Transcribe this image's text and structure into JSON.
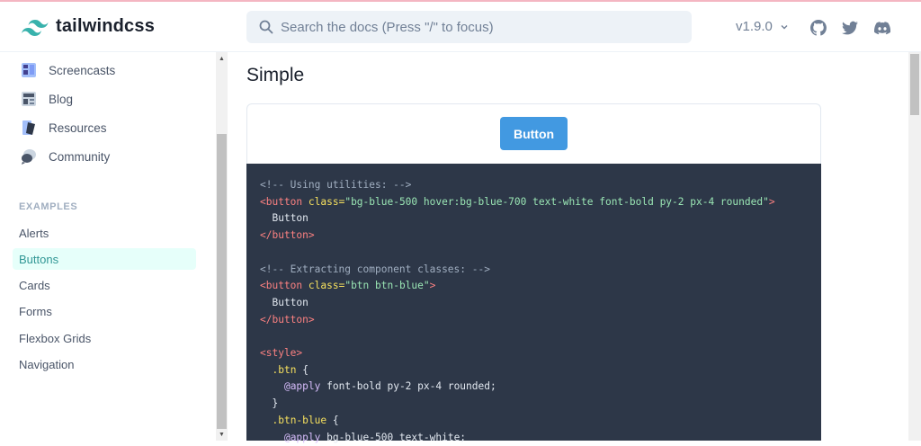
{
  "header": {
    "logo_text": "tailwindcss",
    "search_placeholder": "Search the docs (Press \"/\" to focus)",
    "version": "v1.9.0"
  },
  "sidebar": {
    "links": [
      {
        "label": "Screencasts",
        "icon": "screencast-icon"
      },
      {
        "label": "Blog",
        "icon": "blog-icon"
      },
      {
        "label": "Resources",
        "icon": "resources-icon"
      },
      {
        "label": "Community",
        "icon": "community-icon"
      }
    ],
    "section_title": "EXAMPLES",
    "examples": [
      {
        "label": "Alerts",
        "active": false
      },
      {
        "label": "Buttons",
        "active": true
      },
      {
        "label": "Cards",
        "active": false
      },
      {
        "label": "Forms",
        "active": false
      },
      {
        "label": "Flexbox Grids",
        "active": false
      },
      {
        "label": "Navigation",
        "active": false
      }
    ]
  },
  "main": {
    "heading": "Simple",
    "demo_button": "Button",
    "code": {
      "comment1": "<!-- Using utilities: -->",
      "tag_button_open": "<button",
      "attr_class": "class=",
      "classes1": "\"bg-blue-500 hover:bg-blue-700 text-white font-bold py-2 px-4 rounded\"",
      "tag_close_bracket": ">",
      "button_text": "Button",
      "tag_button_close": "</button>",
      "comment2": "<!-- Extracting component classes: -->",
      "classes2": "\"btn btn-blue\"",
      "tag_style_open": "<style>",
      "sel_btn": ".btn",
      "brace_open": "{",
      "brace_close": "}",
      "at_apply": "@apply",
      "apply1": "font-bold py-2 px-4 rounded;",
      "sel_btn_blue": ".btn-blue",
      "apply2": "bg-blue-500 text-white;"
    }
  },
  "colors": {
    "accent": "#319795",
    "button_blue": "#4299e1",
    "code_bg": "#2d3748"
  }
}
